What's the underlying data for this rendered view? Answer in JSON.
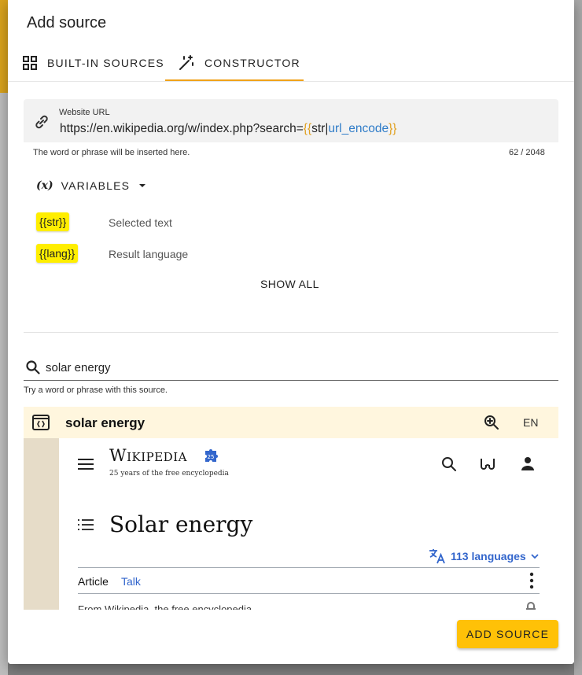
{
  "dialog": {
    "title": "Add source",
    "tabs": [
      {
        "label": "BUILT-IN SOURCES",
        "icon": "grid-icon"
      },
      {
        "label": "CONSTRUCTOR",
        "icon": "magic-wand-icon",
        "active": true
      }
    ]
  },
  "url_field": {
    "label": "Website URL",
    "prefix": "https://en.wikipedia.org/w/index.php?search=",
    "brace_open": "{{",
    "var": "str",
    "pipe": "|",
    "fn": "url_encode",
    "brace_close": "}}",
    "helper": "The word or phrase will be inserted here.",
    "counter": "62 / 2048"
  },
  "variables": {
    "toggle_icon": "(x)",
    "toggle_label": "VARIABLES",
    "items": [
      {
        "chip": "{{str}}",
        "desc": "Selected text"
      },
      {
        "chip": "{{lang}}",
        "desc": "Result language"
      }
    ],
    "show_all": "SHOW ALL"
  },
  "test_search": {
    "value": "solar energy",
    "helper": "Try a word or phrase with this source."
  },
  "preview": {
    "title": "solar energy",
    "lang": "EN",
    "wiki": {
      "logo": "Wikipedia",
      "tagline": "25 years of the free encyclopedia",
      "page_title": "Solar energy",
      "languages": "113 languages",
      "tab_article": "Article",
      "tab_talk": "Talk",
      "from": "From Wikipedia, the free encyclopedia"
    }
  },
  "footer": {
    "add_button": "ADD SOURCE"
  },
  "colors": {
    "accent": "#ffc107",
    "tab_underline": "#f0a21a",
    "chip": "#ffee00",
    "brace": "#e0a020",
    "function": "#2f7cc8",
    "preview_bar": "#fff6de",
    "wiki_link": "#3366cc"
  }
}
